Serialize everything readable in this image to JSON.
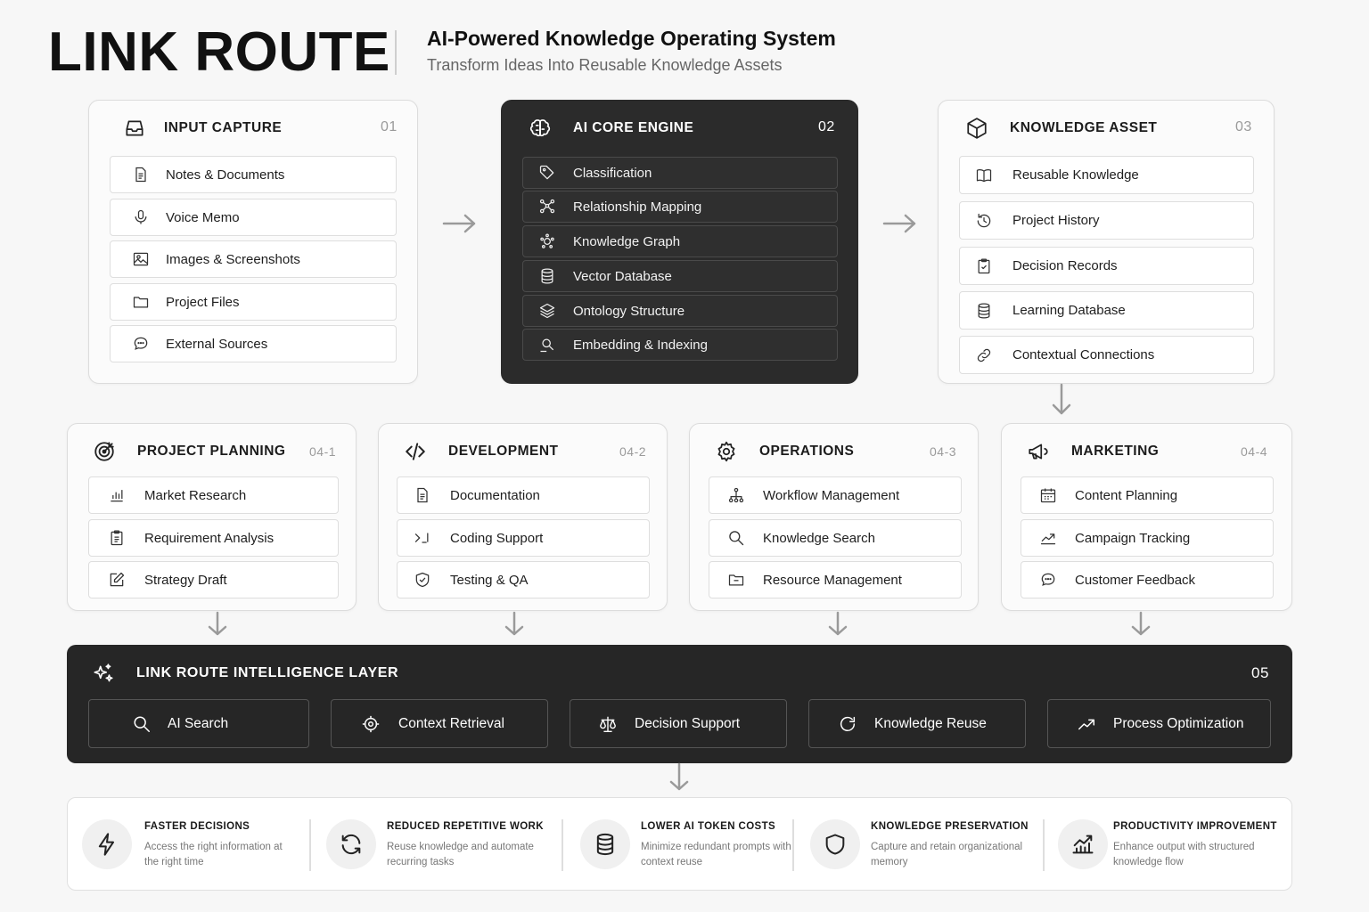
{
  "header": {
    "brand": "LINK ROUTE",
    "tagline": "AI-Powered Knowledge Operating System",
    "subtagline": "Transform Ideas Into Reusable Knowledge Assets"
  },
  "stages": {
    "input": {
      "title": "INPUT CAPTURE",
      "num": "01",
      "icon": "inbox-icon",
      "items": [
        {
          "label": "Notes & Documents",
          "icon": "document-icon"
        },
        {
          "label": "Voice Memo",
          "icon": "microphone-icon"
        },
        {
          "label": "Images & Screenshots",
          "icon": "image-icon"
        },
        {
          "label": "Project Files",
          "icon": "folder-icon"
        },
        {
          "label": "External Sources",
          "icon": "chat-icon"
        }
      ]
    },
    "core": {
      "title": "AI CORE ENGINE",
      "num": "02",
      "icon": "brain-icon",
      "items": [
        {
          "label": "Classification",
          "icon": "tag-icon"
        },
        {
          "label": "Relationship Mapping",
          "icon": "nodes-icon"
        },
        {
          "label": "Knowledge Graph",
          "icon": "graph-icon"
        },
        {
          "label": "Vector Database",
          "icon": "database-icon"
        },
        {
          "label": "Ontology Structure",
          "icon": "layers-icon"
        },
        {
          "label": "Embedding & Indexing",
          "icon": "scan-icon"
        }
      ]
    },
    "asset": {
      "title": "KNOWLEDGE ASSET",
      "num": "03",
      "icon": "cube-icon",
      "items": [
        {
          "label": "Reusable Knowledge",
          "icon": "book-icon"
        },
        {
          "label": "Project History",
          "icon": "history-icon"
        },
        {
          "label": "Decision Records",
          "icon": "clipboard-check-icon"
        },
        {
          "label": "Learning Database",
          "icon": "database-icon"
        },
        {
          "label": "Contextual Connections",
          "icon": "link-icon"
        }
      ]
    }
  },
  "domains": [
    {
      "title": "PROJECT PLANNING",
      "num": "04-1",
      "icon": "target-icon",
      "items": [
        {
          "label": "Market Research",
          "icon": "bar-chart-icon"
        },
        {
          "label": "Requirement Analysis",
          "icon": "clipboard-icon"
        },
        {
          "label": "Strategy Draft",
          "icon": "edit-icon"
        }
      ]
    },
    {
      "title": "DEVELOPMENT",
      "num": "04-2",
      "icon": "code-icon",
      "items": [
        {
          "label": "Documentation",
          "icon": "document-icon"
        },
        {
          "label": "Coding Support",
          "icon": "terminal-icon"
        },
        {
          "label": "Testing & QA",
          "icon": "shield-check-icon"
        }
      ]
    },
    {
      "title": "OPERATIONS",
      "num": "04-3",
      "icon": "gear-icon",
      "items": [
        {
          "label": "Workflow Management",
          "icon": "org-chart-icon"
        },
        {
          "label": "Knowledge Search",
          "icon": "search-icon"
        },
        {
          "label": "Resource Management",
          "icon": "folder-icon"
        }
      ]
    },
    {
      "title": "MARKETING",
      "num": "04-4",
      "icon": "megaphone-icon",
      "items": [
        {
          "label": "Content Planning",
          "icon": "calendar-icon"
        },
        {
          "label": "Campaign Tracking",
          "icon": "trend-icon"
        },
        {
          "label": "Customer Feedback",
          "icon": "chat-icon"
        }
      ]
    }
  ],
  "layer": {
    "title": "LINK ROUTE INTELLIGENCE LAYER",
    "num": "05",
    "icon": "sparkles-icon",
    "items": [
      {
        "label": "AI Search",
        "icon": "search-icon"
      },
      {
        "label": "Context Retrieval",
        "icon": "crosshair-icon"
      },
      {
        "label": "Decision Support",
        "icon": "scale-icon"
      },
      {
        "label": "Knowledge Reuse",
        "icon": "refresh-icon"
      },
      {
        "label": "Process Optimization",
        "icon": "trend-icon"
      }
    ]
  },
  "benefits": [
    {
      "title": "FASTER DECISIONS",
      "desc": "Access the right information at the right time",
      "icon": "lightning-icon"
    },
    {
      "title": "REDUCED REPETITIVE WORK",
      "desc": "Reuse knowledge and automate recurring tasks",
      "icon": "refresh-icon"
    },
    {
      "title": "LOWER AI TOKEN COSTS",
      "desc": "Minimize redundant prompts with context reuse",
      "icon": "database-icon"
    },
    {
      "title": "KNOWLEDGE PRESERVATION",
      "desc": "Capture and retain organizational memory",
      "icon": "shield-icon"
    },
    {
      "title": "PRODUCTIVITY IMPROVEMENT",
      "desc": "Enhance output with structured knowledge flow",
      "icon": "growth-chart-icon"
    }
  ]
}
